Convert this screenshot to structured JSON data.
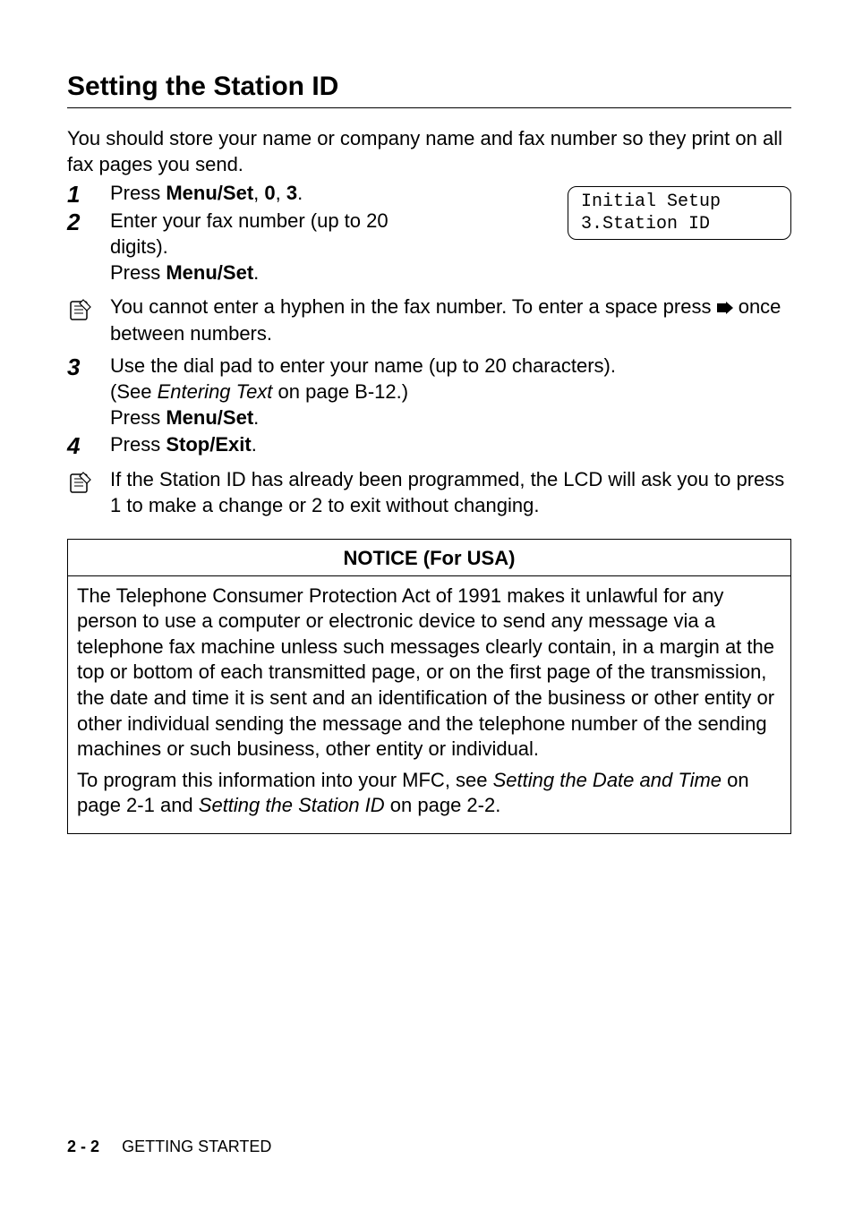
{
  "heading": "Setting the Station ID",
  "intro": "You should store your name or company name and fax number so they print on all fax pages you send.",
  "lcd": {
    "line1": "Initial Setup",
    "line2": "3.Station ID"
  },
  "steps": {
    "s1": {
      "num": "1",
      "t1": "Press ",
      "b1": "Menu/Set",
      "t2": ", ",
      "b2": "0",
      "t3": ", ",
      "b3": "3",
      "t4": "."
    },
    "s2": {
      "num": "2",
      "line1": "Enter your fax number (up to 20 digits).",
      "line2a": "Press ",
      "line2b": "Menu/Set",
      "line2c": "."
    },
    "note1": {
      "t1": "You cannot enter a hyphen in the fax number. To enter a space press ",
      "t2": " once between numbers."
    },
    "s3": {
      "num": "3",
      "line1": "Use the dial pad to enter your name (up to 20 characters).",
      "line2a": "(See ",
      "line2it": "Entering Text",
      "line2b": " on page B-12.)",
      "line3a": "Press ",
      "line3b": "Menu/Set",
      "line3c": "."
    },
    "s4": {
      "num": "4",
      "t1": "Press ",
      "b1": "Stop/Exit",
      "t2": "."
    },
    "note2": {
      "t1": "If the Station ID has already been programmed, the LCD will ask you to press ",
      "b1": "1",
      "t2": " to make a change or ",
      "b2": "2",
      "t3": " to exit without changing."
    }
  },
  "notice": {
    "title": "NOTICE (For USA)",
    "p1": "The Telephone Consumer Protection Act of 1991 makes it unlawful for any person to use a computer or electronic device to send any message via a telephone fax machine unless such messages clearly contain, in a margin at the top or bottom of each transmitted page, or on the first page of the transmission, the date and time it is sent and an identification of the business or other entity or other individual sending the message and the telephone number of the sending machines or such business, other entity or individual.",
    "p2a": "To program this information into your MFC, see ",
    "p2it1": "Setting the Date and Time",
    "p2b": " on page 2-1 and ",
    "p2it2": "Setting the Station ID",
    "p2c": " on page 2-2."
  },
  "footer": {
    "page": "2 - 2",
    "chapter": "GETTING STARTED"
  }
}
